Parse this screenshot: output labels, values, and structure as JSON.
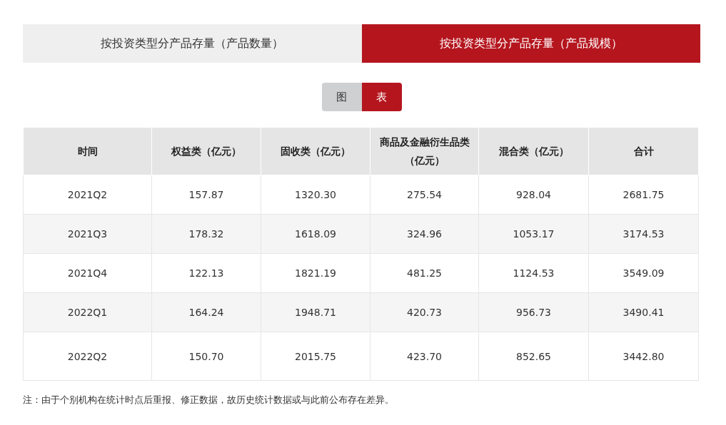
{
  "tabs": [
    {
      "label": "按投资类型分产品存量（产品数量）",
      "selected": false
    },
    {
      "label": "按投资类型分产品存量（产品规模）",
      "selected": true
    }
  ],
  "view_toggle": [
    {
      "label": "图",
      "selected": false
    },
    {
      "label": "表",
      "selected": true
    }
  ],
  "table": {
    "columns": [
      "时间",
      "权益类（亿元）",
      "固收类（亿元）",
      "商品及金融衍生品类（亿元）",
      "混合类（亿元）",
      "合计"
    ],
    "rows": [
      [
        "2021Q2",
        "157.87",
        "1320.30",
        "275.54",
        "928.04",
        "2681.75"
      ],
      [
        "2021Q3",
        "178.32",
        "1618.09",
        "324.96",
        "1053.17",
        "3174.53"
      ],
      [
        "2021Q4",
        "122.13",
        "1821.19",
        "481.25",
        "1124.53",
        "3549.09"
      ],
      [
        "2022Q1",
        "164.24",
        "1948.71",
        "420.73",
        "956.73",
        "3490.41"
      ],
      [
        "2022Q2",
        "150.70",
        "2015.75",
        "423.70",
        "852.65",
        "3442.80"
      ]
    ]
  },
  "note": "注：由于个别机构在统计时点后重报、修正数据，故历史统计数据或与此前公布存在差异。"
}
